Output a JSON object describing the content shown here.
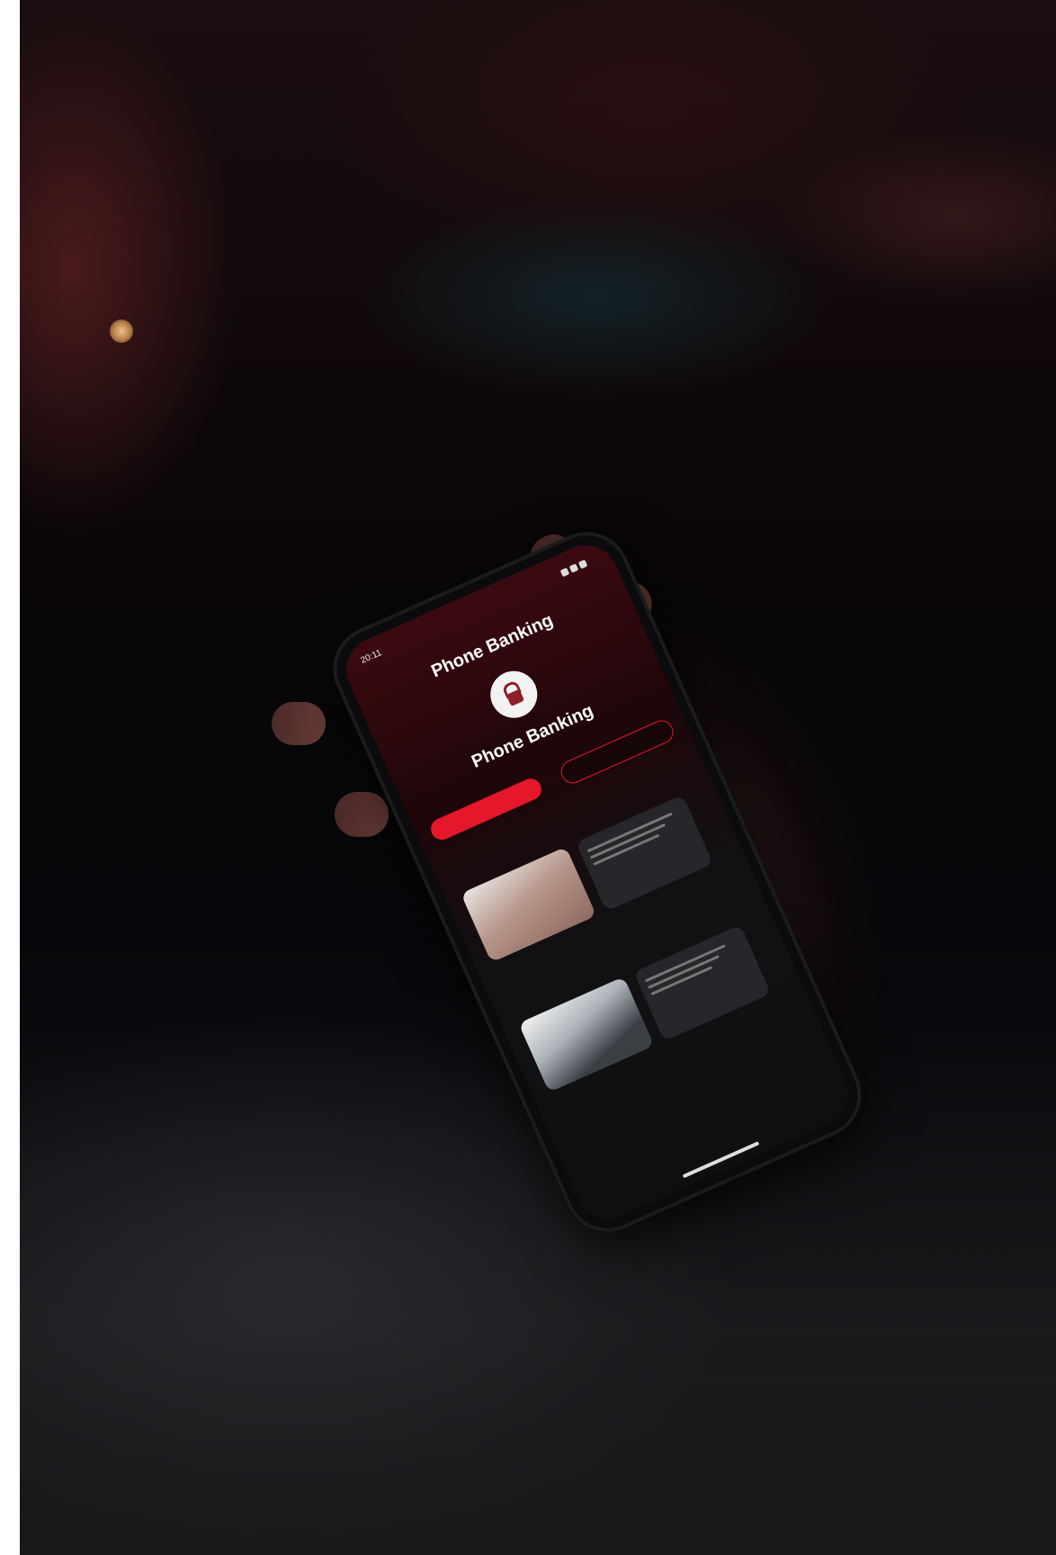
{
  "scene": {
    "description_free": true,
    "colors": {
      "accent": "#e5172a",
      "screen_top": "#3b0a10",
      "background": "#06070a"
    }
  },
  "phone_ui": {
    "status_time": "20:11",
    "title": "Phone Banking",
    "lock_icon": "lock-icon",
    "subtitle": "Phone Banking",
    "tagline": "",
    "primary_button": "",
    "secondary_button": "",
    "section1_title": "",
    "card1_title": "",
    "section2_title": "",
    "card2_title": ""
  }
}
